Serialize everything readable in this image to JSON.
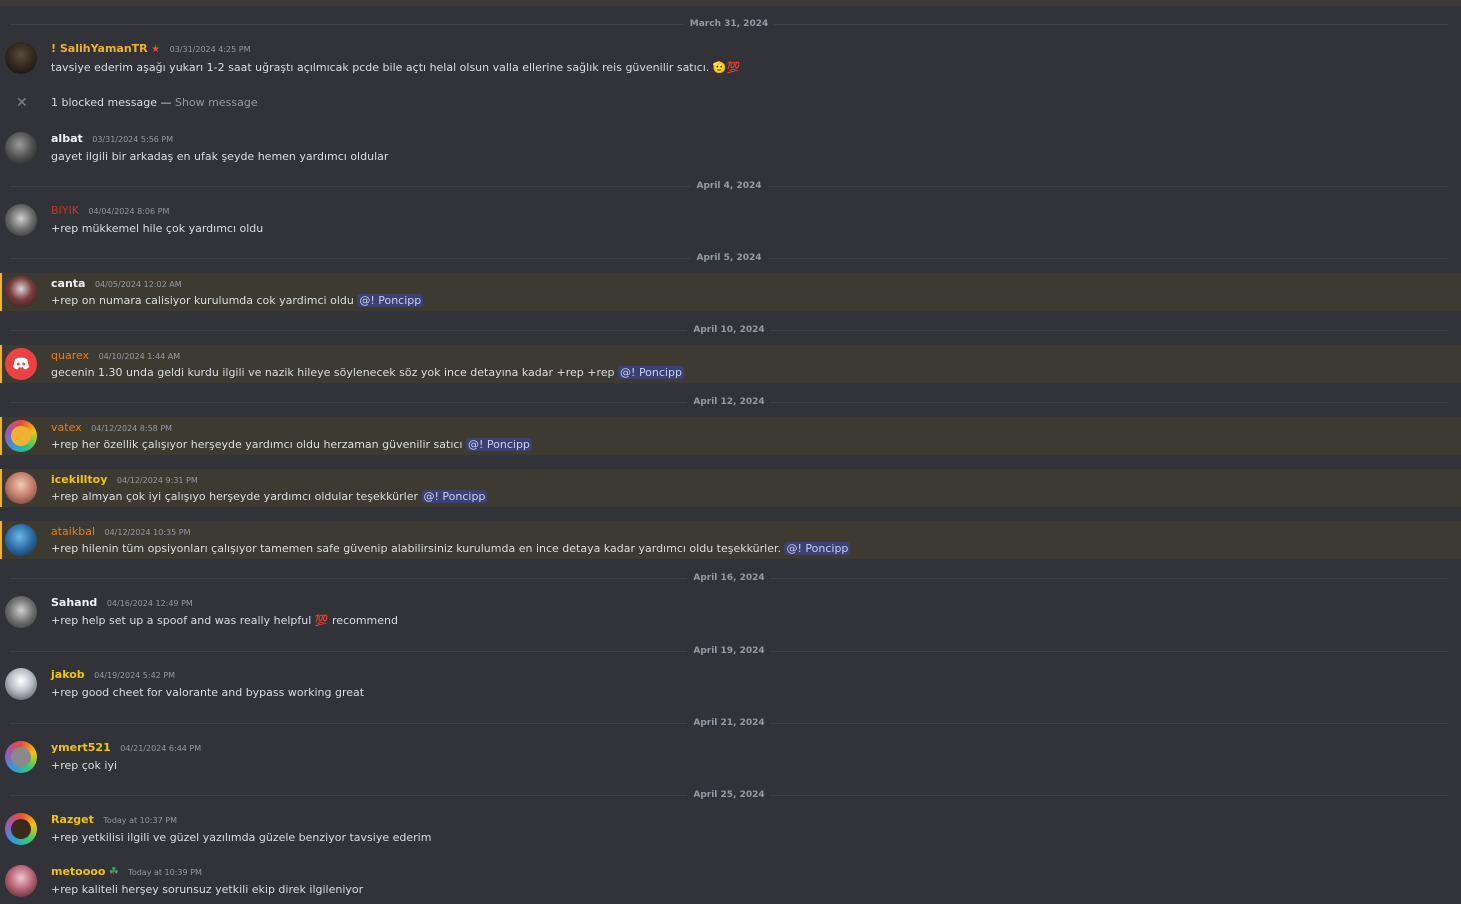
{
  "dividers": [
    "March 31, 2024",
    "April 4, 2024",
    "April 5, 2024",
    "April 10, 2024",
    "April 12, 2024",
    "April 16, 2024",
    "April 19, 2024",
    "April 21, 2024",
    "April 25, 2024"
  ],
  "blocked": {
    "text": "1 blocked message —",
    "show": "Show message"
  },
  "mention_label": "@! Poncipp",
  "messages": [
    {
      "user": "! SalihYamanTR",
      "color": "#f0b232",
      "time": "03/31/2024 4:25 PM",
      "text": "tavsiye ederim aşağı yukarı 1-2 saat uğraştı açılmıcak pcde bile açtı helal olsun valla ellerine sağlık reis güvenilir satıcı.",
      "emoji": "🫡💯"
    },
    {
      "user": "albat",
      "color": "#f2f3f5",
      "time": "03/31/2024 5:56 PM",
      "text": "gayet ilgili bir arkadaş en ufak şeyde hemen yardımcı oldular"
    },
    {
      "user": "BIYIK",
      "color": "#c0392b",
      "time": "04/04/2024 8:06 PM",
      "text": "+rep mükkemel hile çok yardımcı oldu"
    },
    {
      "user": "canta",
      "color": "#f2f3f5",
      "time": "04/05/2024 12:02 AM",
      "text": "+rep on numara calisiyor kurulumda cok yardimci oldu"
    },
    {
      "user": "quarex",
      "color": "#e67e22",
      "time": "04/10/2024 1:44 AM",
      "text": "gecenin 1.30 unda geldi kurdu ilgili ve nazik hileye söylenecek söz yok ince detayına kadar +rep +rep"
    },
    {
      "user": "vatex",
      "color": "#e67e22",
      "time": "04/12/2024 8:58 PM",
      "text": "+rep her özellik çalışıyor herşeyde yardımcı oldu herzaman güvenilir satıcı"
    },
    {
      "user": "icekilltoy",
      "color": "#f1c40f",
      "time": "04/12/2024 9:31 PM",
      "text": "+rep almyan çok iyi çalışıyo herşeyde yardımcı oldular teşekkürler"
    },
    {
      "user": "ataikbal",
      "color": "#e67e22",
      "time": "04/12/2024 10:35 PM",
      "text": "+rep hilenin tüm opsiyonları çalışıyor tamemen safe güvenip alabilirsiniz kurulumda en ince detaya kadar yardımcı oldu teşekkürler."
    },
    {
      "user": "Sahand",
      "color": "#f2f3f5",
      "time": "04/16/2024 12:49 PM",
      "text": "+rep help set up a spoof and was really helpful",
      "emoji": "💯",
      "text_after": "recommend"
    },
    {
      "user": "jakob",
      "color": "#f1c40f",
      "time": "04/19/2024 5:42 PM",
      "text": "+rep good cheet for valorante and bypass working great"
    },
    {
      "user": "ymert521",
      "color": "#f1c40f",
      "time": "04/21/2024 6:44 PM",
      "text": "+rep çok iyi"
    },
    {
      "user": "Razget",
      "color": "#f1c40f",
      "time": "Today at 10:37 PM",
      "text": "+rep yetkilisi ilgili ve güzel yazılımda güzele benziyor tavsiye ederim"
    },
    {
      "user": "metoooo",
      "color": "#f1c40f",
      "time": "Today at 10:39 PM",
      "text": "+rep kaliteli herşey sorunsuz yetkili ekip direk ilgileniyor"
    }
  ]
}
